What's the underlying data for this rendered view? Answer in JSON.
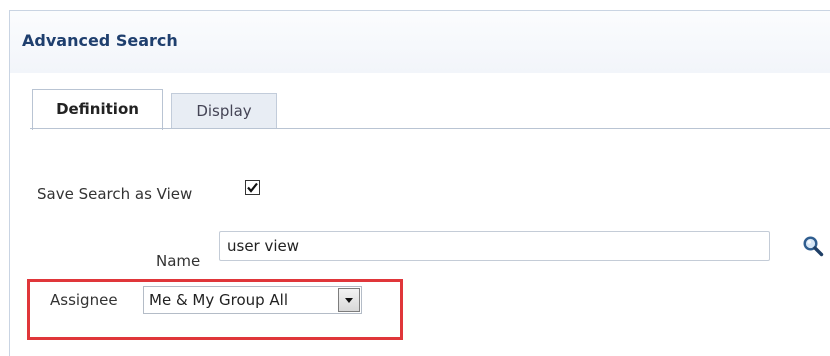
{
  "panel": {
    "title": "Advanced Search"
  },
  "tabs": [
    {
      "label": "Definition",
      "active": true
    },
    {
      "label": "Display",
      "active": false
    }
  ],
  "form": {
    "save_search_label": "Save Search as View",
    "save_search_checked": true,
    "name_label": "Name",
    "name_value": "user view",
    "assignee_label": "Assignee",
    "assignee_value": "Me & My Group All"
  },
  "colors": {
    "highlight_border": "#e0363a",
    "title_color": "#1f3f6e"
  },
  "icons": {
    "search": "magnifier-icon",
    "dropdown": "chevron-down-icon",
    "checkmark": "checkmark-icon"
  }
}
